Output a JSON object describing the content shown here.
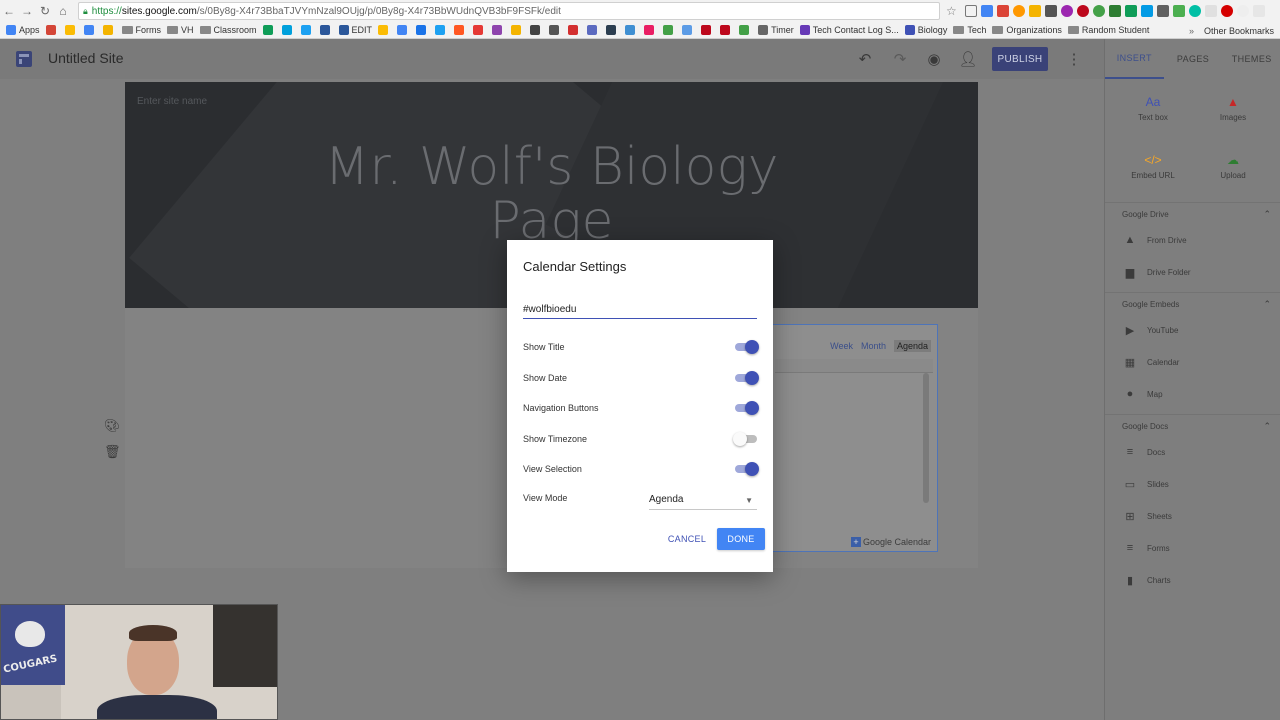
{
  "browser": {
    "url_scheme": "https://",
    "url_host": "sites.google.com",
    "url_path": "/s/0By8g-X4r73BbaTJVYmNzal9OUjg/p/0By8g-X4r73BbWUdnQVB3bF9FSFk/edit",
    "bookmarks": [
      {
        "label": "Apps",
        "icon": "apps-grid-icon",
        "color": "#4285f4"
      },
      {
        "label": "",
        "icon": "gmail-icon",
        "color": "#d44638"
      },
      {
        "label": "",
        "icon": "drive-icon",
        "color": "#fbbc05"
      },
      {
        "label": "",
        "icon": "calendar-icon",
        "color": "#4285f4"
      },
      {
        "label": "",
        "icon": "keep-icon",
        "color": "#f4b400"
      },
      {
        "label": "Forms",
        "icon": "folder-icon",
        "color": "#777777"
      },
      {
        "label": "VH",
        "icon": "folder-icon",
        "color": "#777777"
      },
      {
        "label": "Classroom",
        "icon": "folder-icon",
        "color": "#777777"
      },
      {
        "label": "",
        "icon": "p-icon",
        "color": "#0f9d58"
      },
      {
        "label": "",
        "icon": "circle-icon",
        "color": "#00a0dc"
      },
      {
        "label": "",
        "icon": "chat-icon",
        "color": "#1da1f2"
      },
      {
        "label": "",
        "icon": "w-icon",
        "color": "#2b579a"
      },
      {
        "label": "EDIT",
        "icon": "w-icon",
        "color": "#2b579a"
      },
      {
        "label": "",
        "icon": "pencil-icon",
        "color": "#fbbc05"
      },
      {
        "label": "",
        "icon": "history-icon",
        "color": "#4285f4"
      },
      {
        "label": "",
        "icon": "bookmark-icon",
        "color": "#1a73e8"
      },
      {
        "label": "",
        "icon": "twitter-icon",
        "color": "#1da1f2"
      },
      {
        "label": "",
        "icon": "blogger-icon",
        "color": "#ff5722"
      },
      {
        "label": "",
        "icon": "t-icon",
        "color": "#e53935"
      },
      {
        "label": "",
        "icon": "p-icon",
        "color": "#8e44ad"
      },
      {
        "label": "",
        "icon": "chart-icon",
        "color": "#f4b400"
      },
      {
        "label": "",
        "icon": "bag-icon",
        "color": "#444444"
      },
      {
        "label": "",
        "icon": "mic-icon",
        "color": "#555555"
      },
      {
        "label": "",
        "icon": "shield-icon",
        "color": "#d32f2f"
      },
      {
        "label": "",
        "icon": "puzzle-icon",
        "color": "#5c6bc0"
      },
      {
        "label": "",
        "icon": "q-icon",
        "color": "#2c3e50"
      },
      {
        "label": "",
        "icon": "k-icon",
        "color": "#3f8fd2"
      },
      {
        "label": "",
        "icon": "pinwheel-icon",
        "color": "#e91e63"
      },
      {
        "label": "",
        "icon": "leaf-icon",
        "color": "#43a047"
      },
      {
        "label": "",
        "icon": "globe-icon",
        "color": "#5c9ce6"
      },
      {
        "label": "",
        "icon": "pinterest-icon",
        "color": "#bd081c"
      },
      {
        "label": "",
        "icon": "pinterest-icon",
        "color": "#bd081c"
      },
      {
        "label": "",
        "icon": "leaf-icon",
        "color": "#43a047"
      },
      {
        "label": "Timer",
        "icon": "puzzle-icon",
        "color": "#666666"
      },
      {
        "label": "Tech Contact Log S...",
        "icon": "form-icon",
        "color": "#673ab7"
      },
      {
        "label": "Biology",
        "icon": "site-icon",
        "color": "#3f51b5"
      },
      {
        "label": "Tech",
        "icon": "folder-icon",
        "color": "#777777"
      },
      {
        "label": "Organizations",
        "icon": "folder-icon",
        "color": "#777777"
      },
      {
        "label": "Random Student",
        "icon": "folder-icon",
        "color": "#777777"
      }
    ],
    "bookmarks_overflow": "»",
    "other_bookmarks": "Other Bookmarks"
  },
  "toolbar": {
    "site_title": "Untitled Site",
    "publish_label": "PUBLISH"
  },
  "page": {
    "site_name_placeholder": "Enter site name",
    "hero_title_line1": "Mr. Wolf's Biology",
    "hero_title_line2": "Page"
  },
  "calendar_embed": {
    "tabs": [
      "Week",
      "Month",
      "Agenda"
    ],
    "active_tab": "Agenda",
    "footer_label": "Google Calendar"
  },
  "side_panel": {
    "tabs": [
      "INSERT",
      "PAGES",
      "THEMES"
    ],
    "active_tab": "INSERT",
    "insert_items": [
      {
        "label": "Text box",
        "icon": "text-box-icon",
        "glyph": "Aa",
        "color": "#3f51b5"
      },
      {
        "label": "Images",
        "icon": "image-icon",
        "glyph": "▲",
        "color": "#c62828"
      },
      {
        "label": "Embed URL",
        "icon": "embed-icon",
        "glyph": "</>",
        "color": "#f9a825"
      },
      {
        "label": "Upload",
        "icon": "cloud-upload-icon",
        "glyph": "☁",
        "color": "#2e7d32"
      }
    ],
    "sections": [
      {
        "title": "Google Drive",
        "items": [
          {
            "label": "From Drive",
            "icon": "drive-icon",
            "glyph": "▲"
          },
          {
            "label": "Drive Folder",
            "icon": "drive-folder-icon",
            "glyph": "▆"
          }
        ]
      },
      {
        "title": "Google Embeds",
        "items": [
          {
            "label": "YouTube",
            "icon": "youtube-icon",
            "glyph": "▶"
          },
          {
            "label": "Calendar",
            "icon": "calendar-icon",
            "glyph": "▦"
          },
          {
            "label": "Map",
            "icon": "map-pin-icon",
            "glyph": "●"
          }
        ]
      },
      {
        "title": "Google Docs",
        "items": [
          {
            "label": "Docs",
            "icon": "docs-icon",
            "glyph": "≡"
          },
          {
            "label": "Slides",
            "icon": "slides-icon",
            "glyph": "▭"
          },
          {
            "label": "Sheets",
            "icon": "sheets-icon",
            "glyph": "⊞"
          },
          {
            "label": "Forms",
            "icon": "forms-icon",
            "glyph": "≡"
          },
          {
            "label": "Charts",
            "icon": "charts-icon",
            "glyph": "▮"
          }
        ]
      }
    ]
  },
  "dialog": {
    "title": "Calendar Settings",
    "calendar_id_value": "#wolfbioedu",
    "toggles": [
      {
        "label": "Show Title",
        "on": true
      },
      {
        "label": "Show Date",
        "on": true
      },
      {
        "label": "Navigation Buttons",
        "on": true
      },
      {
        "label": "Show Timezone",
        "on": false
      },
      {
        "label": "View Selection",
        "on": true
      }
    ],
    "view_mode_label": "View Mode",
    "view_mode_value": "Agenda",
    "cancel_label": "CANCEL",
    "done_label": "DONE"
  },
  "webcam": {
    "banner_text": "COUGARS"
  }
}
